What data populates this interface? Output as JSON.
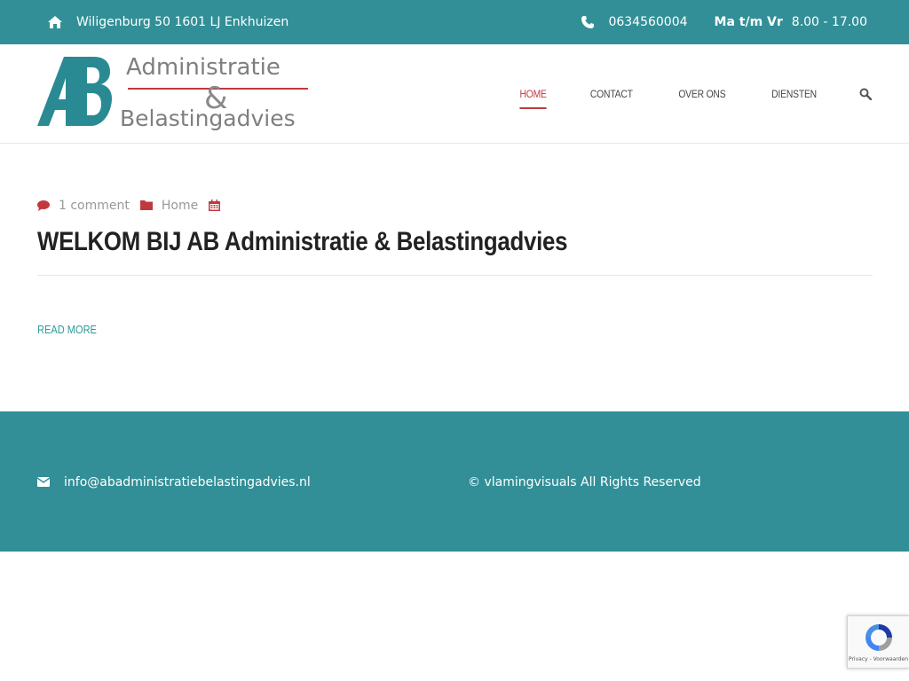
{
  "topbar": {
    "address": "Wiligenburg 50 1601 LJ Enkhuizen",
    "address_icon": "home-icon",
    "phone": "0634560004",
    "phone_icon": "phone-icon",
    "hours_label": "Ma t/m Vr",
    "hours_value": "8.00 - 17.00"
  },
  "logo": {
    "mark": "AB",
    "line1": "Administratie",
    "ampersand": "&",
    "line2": "Belastingadvies"
  },
  "nav": {
    "items": [
      {
        "label": "HOME",
        "active": true
      },
      {
        "label": "CONTACT",
        "active": false
      },
      {
        "label": "OVER ONS",
        "active": false
      },
      {
        "label": "DIENSTEN",
        "active": false
      }
    ],
    "search_icon": "search-icon"
  },
  "post": {
    "comments": "1 comment",
    "category": "Home",
    "title": "WELKOM BIJ AB Administratie & Belastingadvies",
    "read_more": "READ MORE"
  },
  "footer": {
    "email": "info@abadministratiebelastingadvies.nl",
    "copyright": "© vlamingvisuals All Rights Reserved"
  },
  "recaptcha": {
    "text": "Privacy - Voorwaarden"
  },
  "colors": {
    "teal": "#328f97",
    "accent_red": "#c0393f",
    "link_teal": "#2a9b98"
  }
}
